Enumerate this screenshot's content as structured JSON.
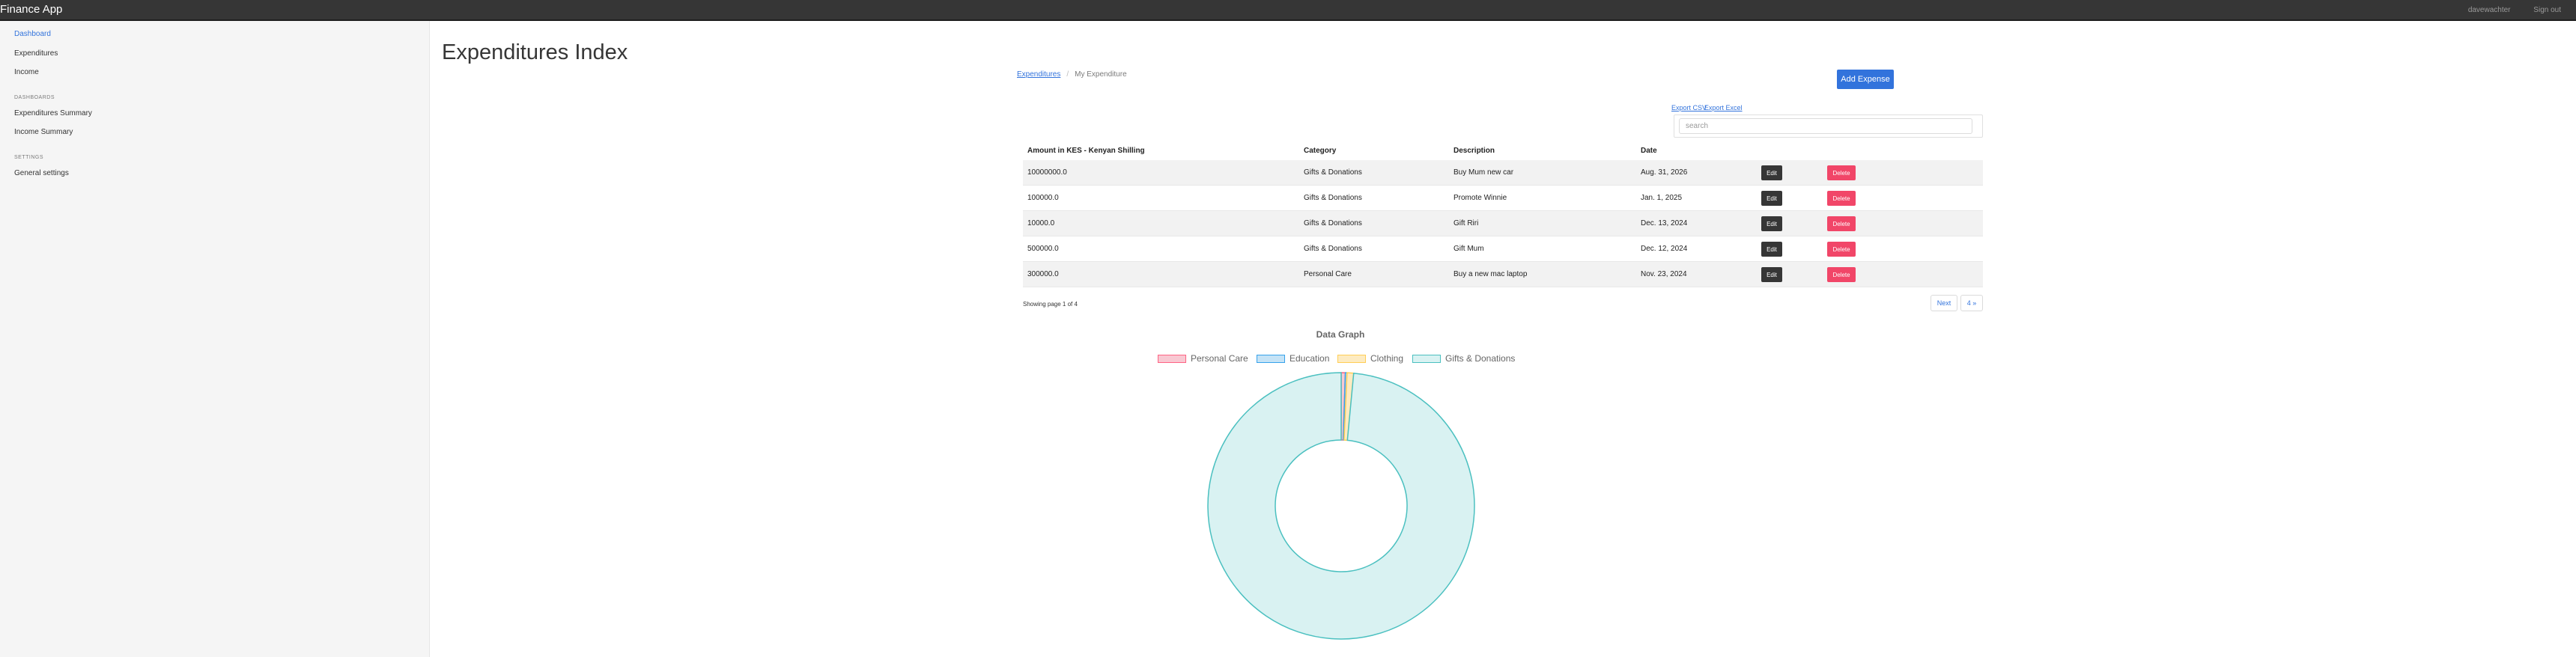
{
  "app": {
    "brand": "Finance App"
  },
  "topnav": {
    "user": "davewachter",
    "signout": "Sign out"
  },
  "sidebar": {
    "items": [
      {
        "label": "Dashboard",
        "active": true
      },
      {
        "label": "Expenditures"
      },
      {
        "label": "Income"
      }
    ],
    "sections": [
      {
        "heading": "DASHBOARDS",
        "items": [
          {
            "label": "Expenditures Summary"
          },
          {
            "label": "Income Summary"
          }
        ]
      },
      {
        "heading": "SETTINGS",
        "items": [
          {
            "label": "General settings"
          }
        ]
      }
    ]
  },
  "page": {
    "title": "Expenditures Index"
  },
  "breadcrumb": {
    "parent": "Expenditures",
    "current": "My Expenditure"
  },
  "actions": {
    "add_label": "Add Expense",
    "export_csv": "Export CSV",
    "export_excel": "Export Excel"
  },
  "search": {
    "placeholder": "search",
    "value": ""
  },
  "table": {
    "headers": [
      "Amount in KES - Kenyan Shilling",
      "Category",
      "Description",
      "Date"
    ],
    "edit_label": "Edit",
    "delete_label": "Delete",
    "rows": [
      {
        "amount": "10000000.0",
        "category": "Gifts & Donations",
        "description": "Buy Mum new car",
        "date": "Aug. 31, 2026"
      },
      {
        "amount": "100000.0",
        "category": "Gifts & Donations",
        "description": "Promote Winnie",
        "date": "Jan. 1, 2025"
      },
      {
        "amount": "10000.0",
        "category": "Gifts & Donations",
        "description": "Gift Riri",
        "date": "Dec. 13, 2024"
      },
      {
        "amount": "500000.0",
        "category": "Gifts & Donations",
        "description": "Gift Mum",
        "date": "Dec. 12, 2024"
      },
      {
        "amount": "300000.0",
        "category": "Personal Care",
        "description": "Buy a new mac laptop",
        "date": "Nov. 23, 2024"
      }
    ]
  },
  "pagination": {
    "info": "Showing page 1 of 4",
    "next": "Next",
    "last": "4 »"
  },
  "chart_data": {
    "type": "pie",
    "title": "Data Graph",
    "categories": [
      "Personal Care",
      "Education",
      "Clothing",
      "Gifts & Donations"
    ],
    "values": [
      0.5,
      0.2,
      0.8,
      98.5
    ],
    "colors": [
      "#f8c8d2",
      "#c5e3f6",
      "#fdebc1",
      "#d9f2f2"
    ],
    "borders": [
      "#ff6384",
      "#36a2eb",
      "#ffce56",
      "#4bc0c0"
    ],
    "legend": "top"
  }
}
